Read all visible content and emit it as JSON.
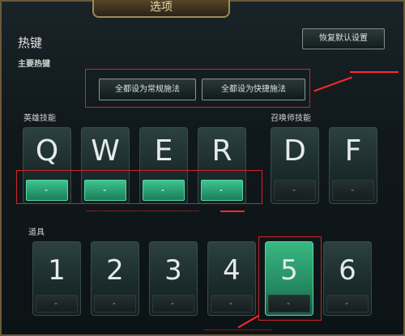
{
  "window": {
    "title": "选项"
  },
  "header": {
    "title": "热键",
    "reset_label": "恢复默认设置"
  },
  "primary": {
    "label": "主要热键",
    "buttons": [
      "全都设为常规施法",
      "全都设为快捷施法"
    ]
  },
  "hero": {
    "label": "英雄技能",
    "keys": [
      {
        "letter": "Q",
        "quickcast": true
      },
      {
        "letter": "W",
        "quickcast": true
      },
      {
        "letter": "E",
        "quickcast": true
      },
      {
        "letter": "R",
        "quickcast": true
      }
    ]
  },
  "summoner": {
    "label": "召唤师技能",
    "keys": [
      {
        "letter": "D",
        "quickcast": false
      },
      {
        "letter": "F",
        "quickcast": false
      }
    ]
  },
  "items": {
    "label": "道具",
    "keys": [
      {
        "label": "1",
        "selected": false
      },
      {
        "label": "2",
        "selected": false
      },
      {
        "label": "3",
        "selected": false
      },
      {
        "label": "4",
        "selected": false
      },
      {
        "label": "5",
        "selected": true
      },
      {
        "label": "6",
        "selected": false
      }
    ]
  },
  "colors": {
    "annotation": "#ff2a2a",
    "quickcast_active": "#2fb37f",
    "frame_gold": "#a18a55"
  }
}
